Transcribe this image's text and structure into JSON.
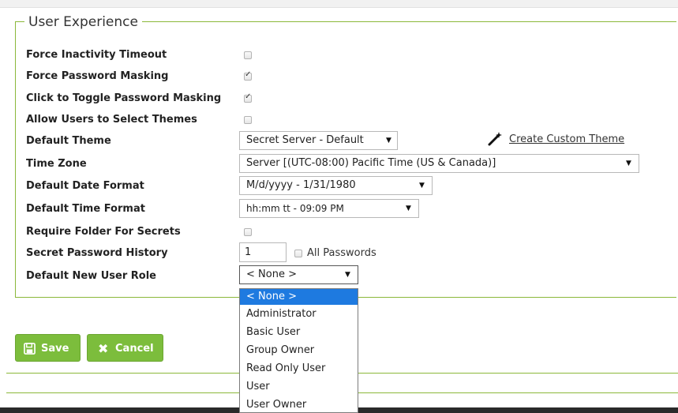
{
  "section_title": "User Experience",
  "settings": {
    "force_inactivity_timeout": {
      "label": "Force Inactivity Timeout",
      "checked": false
    },
    "force_password_masking": {
      "label": "Force Password Masking",
      "checked": true
    },
    "click_toggle_masking": {
      "label": "Click to Toggle Password Masking",
      "checked": true
    },
    "allow_select_themes": {
      "label": "Allow Users to Select Themes",
      "checked": false
    },
    "default_theme": {
      "label": "Default Theme",
      "value": "Secret Server - Default"
    },
    "time_zone": {
      "label": "Time Zone",
      "value": "Server [(UTC-08:00) Pacific Time (US & Canada)]"
    },
    "default_date_format": {
      "label": "Default Date Format",
      "value": "M/d/yyyy - 1/31/1980"
    },
    "default_time_format": {
      "label": "Default Time Format",
      "value": "hh:mm tt - 09:09 PM"
    },
    "require_folder": {
      "label": "Require Folder For Secrets",
      "checked": false
    },
    "secret_password_history": {
      "label": "Secret Password History",
      "value": "1",
      "all_passwords_label": "All Passwords",
      "all_passwords_checked": false
    },
    "default_new_user_role": {
      "label": "Default New User Role",
      "value": "< None >"
    }
  },
  "create_custom_theme_link": "Create Custom Theme",
  "role_options": [
    "< None >",
    "Administrator",
    "Basic User",
    "Group Owner",
    "Read Only User",
    "User",
    "User Owner"
  ],
  "buttons": {
    "save": "Save",
    "cancel": "Cancel"
  },
  "colors": {
    "accent_green": "#7cbd3c",
    "border_green": "#8bb83a",
    "selected_blue": "#1e7ae0"
  },
  "icons": {
    "save": "floppy-disk-icon",
    "cancel": "x-icon",
    "theme": "magic-wand-icon"
  }
}
